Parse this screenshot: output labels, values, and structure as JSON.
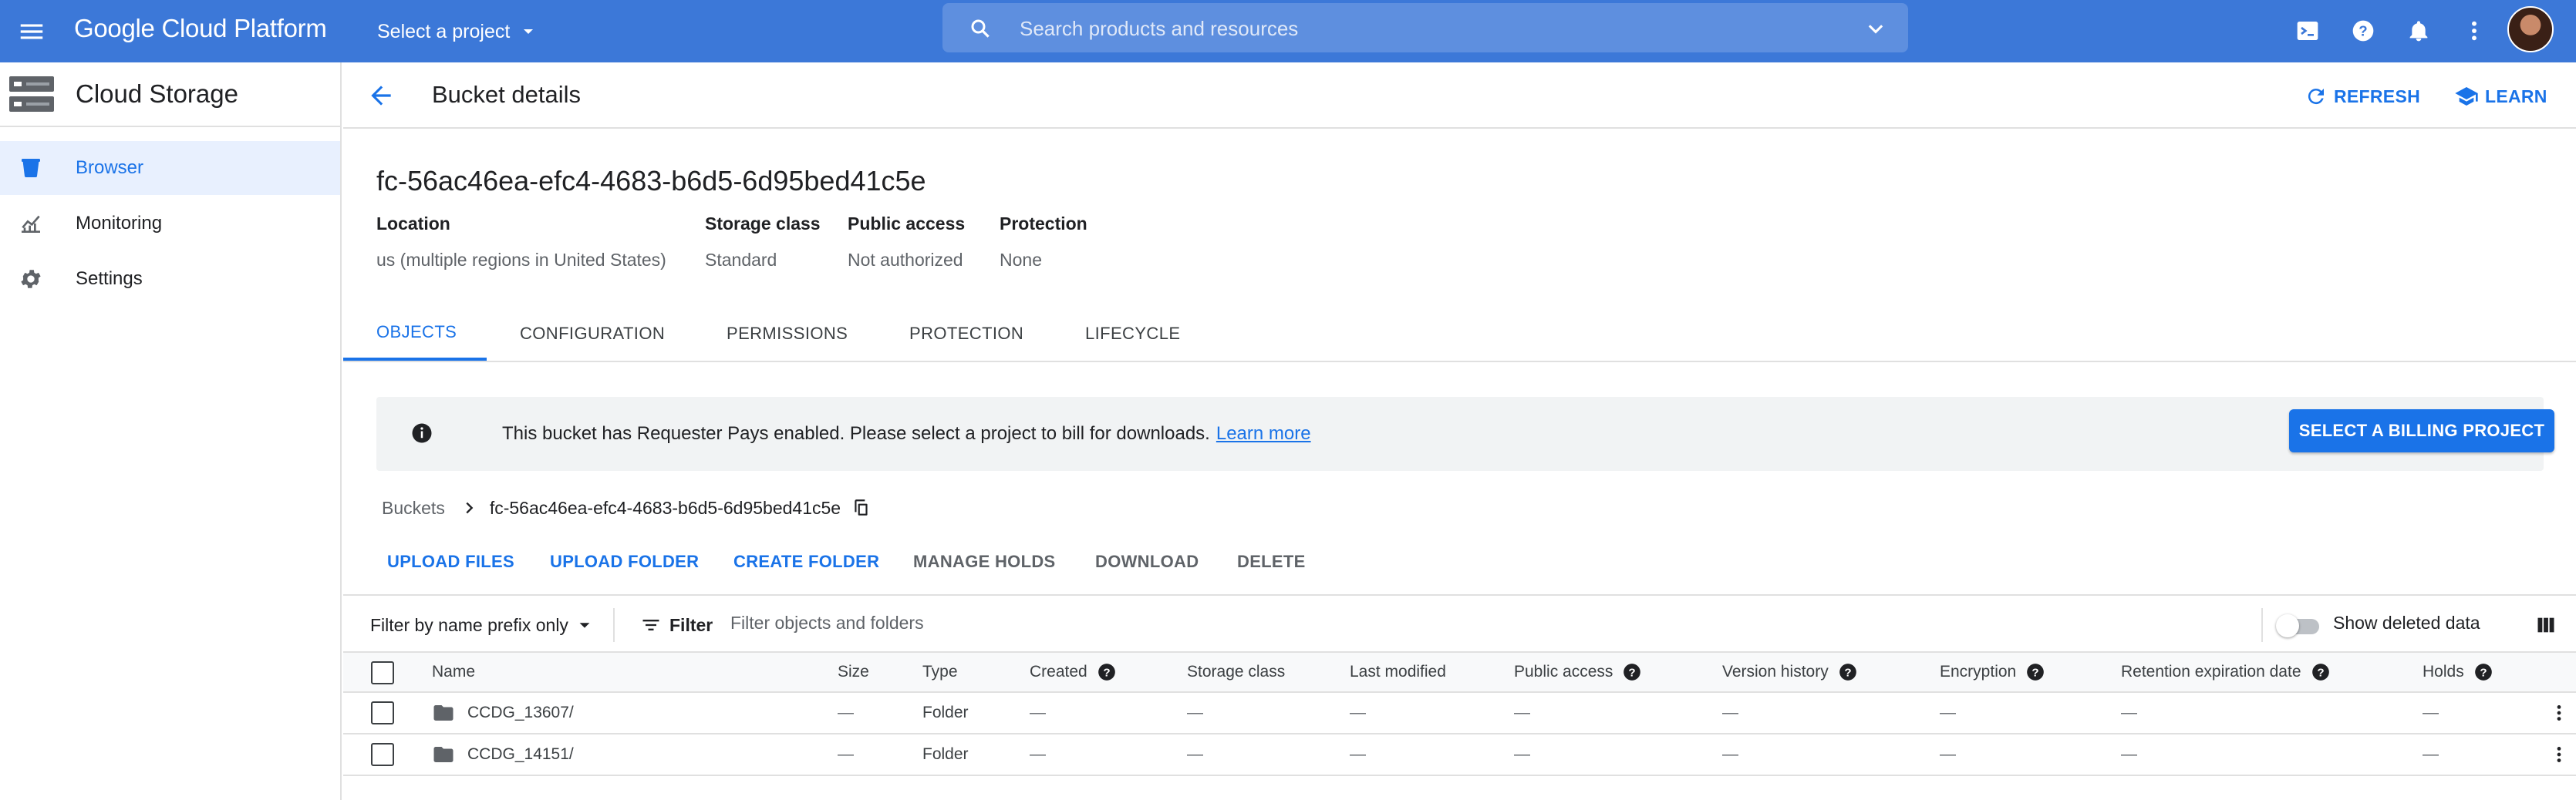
{
  "topbar": {
    "brand": "Google Cloud Platform",
    "project_selector": "Select a project",
    "search_placeholder": "Search products and resources"
  },
  "sidebar": {
    "title": "Cloud Storage",
    "items": [
      {
        "label": "Browser",
        "icon": "bucket-icon",
        "active": true
      },
      {
        "label": "Monitoring",
        "icon": "monitoring-icon",
        "active": false
      },
      {
        "label": "Settings",
        "icon": "gear-icon",
        "active": false
      }
    ]
  },
  "header": {
    "title": "Bucket details",
    "refresh_label": "REFRESH",
    "learn_label": "LEARN"
  },
  "bucket": {
    "name": "fc-56ac46ea-efc4-4683-b6d5-6d95bed41c5e",
    "meta": [
      {
        "key": "Location",
        "value": "us (multiple regions in United States)"
      },
      {
        "key": "Storage class",
        "value": "Standard"
      },
      {
        "key": "Public access",
        "value": "Not authorized"
      },
      {
        "key": "Protection",
        "value": "None"
      }
    ]
  },
  "tabs": [
    "OBJECTS",
    "CONFIGURATION",
    "PERMISSIONS",
    "PROTECTION",
    "LIFECYCLE"
  ],
  "active_tab": "OBJECTS",
  "banner": {
    "text": "This bucket has Requester Pays enabled. Please select a project to bill for downloads.",
    "link": "Learn more",
    "button": "SELECT A BILLING PROJECT"
  },
  "breadcrumb": {
    "root": "Buckets",
    "current": "fc-56ac46ea-efc4-4683-b6d5-6d95bed41c5e"
  },
  "actions": {
    "upload_files": "UPLOAD FILES",
    "upload_folder": "UPLOAD FOLDER",
    "create_folder": "CREATE FOLDER",
    "manage_holds": "MANAGE HOLDS",
    "download": "DOWNLOAD",
    "delete": "DELETE"
  },
  "filterbar": {
    "prefix_label": "Filter by name prefix only",
    "filter_label": "Filter",
    "filter_placeholder": "Filter objects and folders",
    "show_deleted_label": "Show deleted data",
    "show_deleted": false
  },
  "table": {
    "columns": {
      "name": "Name",
      "size": "Size",
      "type": "Type",
      "created": "Created",
      "storage_class": "Storage class",
      "last_modified": "Last modified",
      "public_access": "Public access",
      "version_history": "Version history",
      "encryption": "Encryption",
      "retention": "Retention expiration date",
      "holds": "Holds"
    },
    "rows": [
      {
        "name": "CCDG_13607/",
        "size": "—",
        "type": "Folder",
        "created": "—",
        "storage_class": "—",
        "last_modified": "—",
        "public_access": "—",
        "version_history": "—",
        "encryption": "—",
        "retention": "—",
        "holds": "—"
      },
      {
        "name": "CCDG_14151/",
        "size": "—",
        "type": "Folder",
        "created": "—",
        "storage_class": "—",
        "last_modified": "—",
        "public_access": "—",
        "version_history": "—",
        "encryption": "—",
        "retention": "—",
        "holds": "—"
      }
    ]
  },
  "colors": {
    "topbar": "#3c78d8",
    "accent": "#1a73e8",
    "active_nav_bg": "#e8f0fe",
    "banner_bg": "#f1f3f4"
  }
}
